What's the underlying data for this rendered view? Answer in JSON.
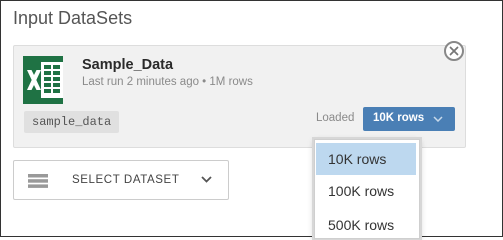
{
  "section": {
    "title": "Input DataSets"
  },
  "dataset": {
    "name": "Sample_Data",
    "meta": "Last run 2 minutes ago • 1M rows",
    "id": "sample_data",
    "file_icon": "excel-icon",
    "loaded_label": "Loaded",
    "rows_selected": "10K rows"
  },
  "rows_options": [
    "10K rows",
    "100K rows",
    "500K rows"
  ],
  "select_dataset": {
    "label": "SELECT DATASET",
    "icon": "list-icon"
  },
  "colors": {
    "accent": "#4a7fb5",
    "excel_green": "#1f7244",
    "option_highlight": "#bdd8ef"
  }
}
